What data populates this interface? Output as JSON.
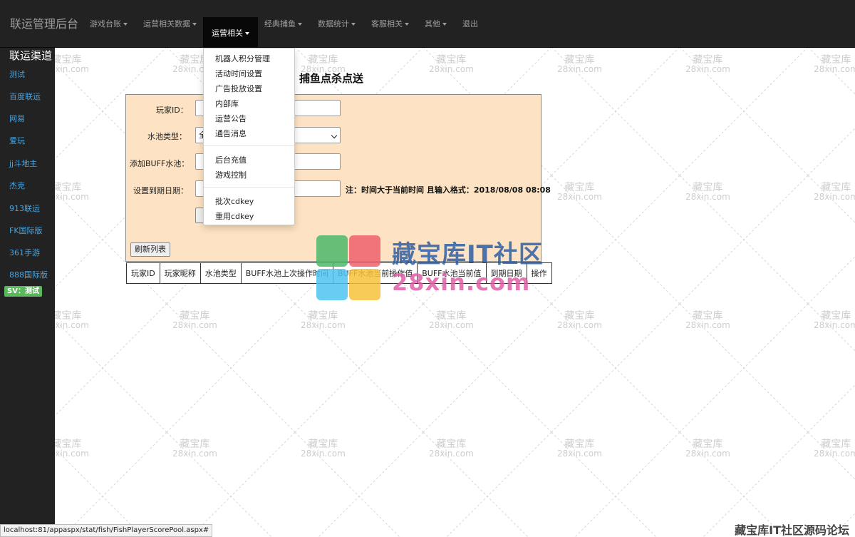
{
  "app": {
    "brand": "联运管理后台"
  },
  "nav": {
    "items": [
      {
        "label": "游戏台账",
        "dropdown": true
      },
      {
        "label": "运营相关数据",
        "dropdown": true
      },
      {
        "label": "运营相关",
        "dropdown": true,
        "active": true
      },
      {
        "label": "经典捕鱼",
        "dropdown": true
      },
      {
        "label": "数据统计",
        "dropdown": true
      },
      {
        "label": "客服相关",
        "dropdown": true
      },
      {
        "label": "其他",
        "dropdown": true
      },
      {
        "label": "退出",
        "dropdown": false
      }
    ]
  },
  "dropdown_menu": {
    "items": [
      "机器人积分管理",
      "活动时间设置",
      "广告投放设置",
      "内部库",
      "运营公告",
      "通告消息",
      "后台充值",
      "游戏控制",
      "批次cdkey",
      "重用cdkey"
    ]
  },
  "sidebar": {
    "title": "联运渠道",
    "items": [
      "测试",
      "百度联运",
      "网易",
      "爱玩",
      "jj斗地主",
      "杰克",
      "913联运",
      "FK国际版",
      "361手游",
      "888国际版"
    ],
    "badge": "SV：测试"
  },
  "main": {
    "title": "捕鱼点杀点送",
    "form": {
      "player_id_label": "玩家ID：",
      "pool_type_label": "水池类型：",
      "pool_type_selected": "全",
      "add_buff_label": "添加BUFF水池：",
      "expire_label": "设置到期日期：",
      "note": "注：时间大于当前时间 且输入格式：2018/08/08 08:08",
      "refresh_button": "刷新列表"
    },
    "table": {
      "headers": [
        "玩家ID",
        "玩家昵称",
        "水池类型",
        "BUFF水池上次操作时间",
        "BUFF水池当前操作值",
        "BUFF水池当前值",
        "到期日期",
        "操作"
      ]
    }
  },
  "watermark": {
    "cn": "藏宝库",
    "en": "28xin.com",
    "logo_cn": "藏宝库IT社区",
    "logo_en": "28xin.com"
  },
  "status_bar": {
    "url": "localhost:81/appaspx/stat/fish/FishPlayerScorePool.aspx#"
  },
  "bottom_watermark": "藏宝库IT社区源码论坛"
}
